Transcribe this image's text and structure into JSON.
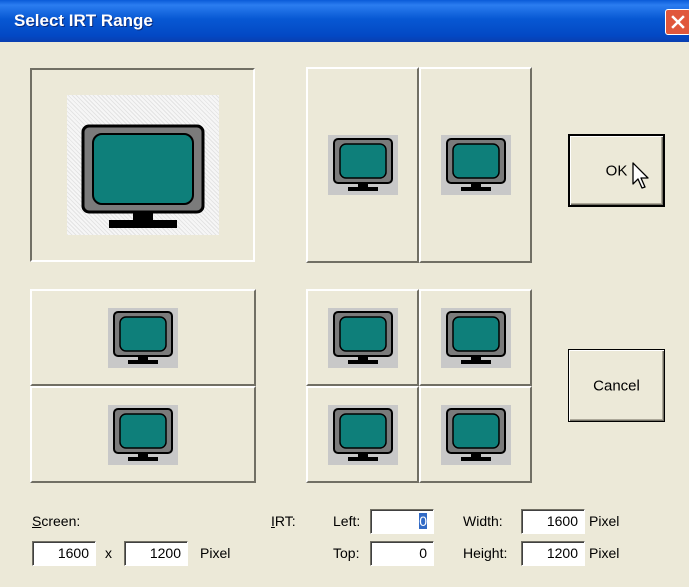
{
  "window": {
    "title": "Select IRT Range"
  },
  "icons": {
    "close": "close-icon",
    "monitor": "monitor-icon",
    "cursor": "mouse-pointer-icon"
  },
  "colors": {
    "screen": "#0e7f7a",
    "bezel": "#7b7b7b",
    "titlebar": "#0758d3"
  },
  "buttons": {
    "ok": "OK",
    "cancel": "Cancel"
  },
  "screen": {
    "label_prefix": "",
    "label_mnemonic": "S",
    "label_rest": "creen:",
    "width": "1600",
    "x_label": "x",
    "height": "1200",
    "unit": "Pixel"
  },
  "irt": {
    "label_mnemonic": "I",
    "label_rest": "RT:",
    "left_label": "Left:",
    "left_value": "0",
    "top_label": "Top:",
    "top_value": "0",
    "width_label": "Width:",
    "width_value": "1600",
    "width_unit": "Pixel",
    "height_label": "Height:",
    "height_value": "1200",
    "height_unit": "Pixel"
  }
}
